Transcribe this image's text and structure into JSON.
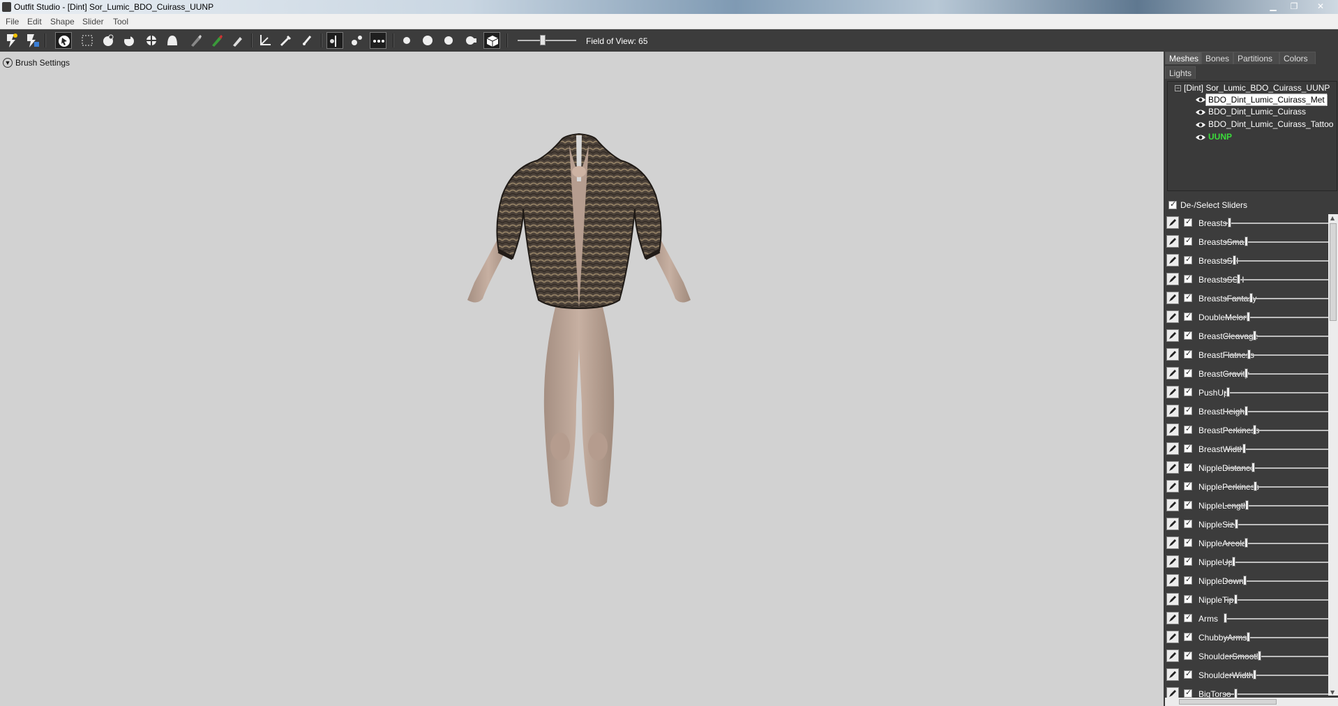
{
  "window": {
    "title": "Outfit Studio - [Dint] Sor_Lumic_BDO_Cuirass_UUNP",
    "controls": [
      "minimize-icon",
      "maximize-icon",
      "close-icon"
    ]
  },
  "menu": [
    "File",
    "Edit",
    "Shape",
    "Slider",
    "Tool"
  ],
  "toolbar": {
    "field_of_view_label": "Field of View: 65",
    "field_of_view_value": 65
  },
  "viewport": {
    "brush_settings_label": "Brush Settings"
  },
  "right_panel": {
    "tabs": [
      "Meshes",
      "Bones",
      "Partitions",
      "Colors",
      "Lights"
    ],
    "active_tab": "Meshes",
    "tree": {
      "root": "[Dint] Sor_Lumic_BDO_Cuirass_UUNP",
      "children": [
        {
          "name": "BDO_Dint_Lumic_Cuirass_Met",
          "selected": true
        },
        {
          "name": "BDO_Dint_Lumic_Cuirass",
          "selected": false
        },
        {
          "name": "BDO_Dint_Lumic_Cuirass_Tattoo",
          "selected": false
        },
        {
          "name": "UUNP",
          "selected": false,
          "highlight": "#3bdc3b"
        }
      ]
    },
    "sliders_header": "De-/Select Sliders",
    "sliders": [
      {
        "name": "Breasts",
        "value": 0.04
      },
      {
        "name": "BreastsSmall",
        "value": 0.2
      },
      {
        "name": "BreastsSH",
        "value": 0.09
      },
      {
        "name": "BreastsSSH",
        "value": 0.13
      },
      {
        "name": "BreastsFantasy",
        "value": 0.25
      },
      {
        "name": "DoubleMelon",
        "value": 0.22
      },
      {
        "name": "BreastCleavage",
        "value": 0.28
      },
      {
        "name": "BreastFlatness",
        "value": 0.23
      },
      {
        "name": "BreastGravity",
        "value": 0.2
      },
      {
        "name": "PushUp",
        "value": 0.03
      },
      {
        "name": "BreastHeight",
        "value": 0.2
      },
      {
        "name": "BreastPerkiness",
        "value": 0.28
      },
      {
        "name": "BreastWidth",
        "value": 0.18
      },
      {
        "name": "NippleDistance",
        "value": 0.27
      },
      {
        "name": "NipplePerkiness",
        "value": 0.29
      },
      {
        "name": "NippleLength",
        "value": 0.21
      },
      {
        "name": "NippleSize",
        "value": 0.11
      },
      {
        "name": "NippleAreola",
        "value": 0.2
      },
      {
        "name": "NippleUp",
        "value": 0.08
      },
      {
        "name": "NippleDown",
        "value": 0.19
      },
      {
        "name": "NippleTip",
        "value": 0.1
      },
      {
        "name": "Arms",
        "value": 0.0
      },
      {
        "name": "ChubbyArms",
        "value": 0.22
      },
      {
        "name": "ShoulderSmooth",
        "value": 0.33
      },
      {
        "name": "ShoulderWidth",
        "value": 0.28
      },
      {
        "name": "BigTorso",
        "value": 0.1
      }
    ]
  },
  "colors": {
    "toolbar_bg": "#3c3c3c",
    "viewport_bg": "#d2d2d2",
    "panel_bg": "#3c3c3c",
    "highlight_green": "#3bdc3b"
  }
}
